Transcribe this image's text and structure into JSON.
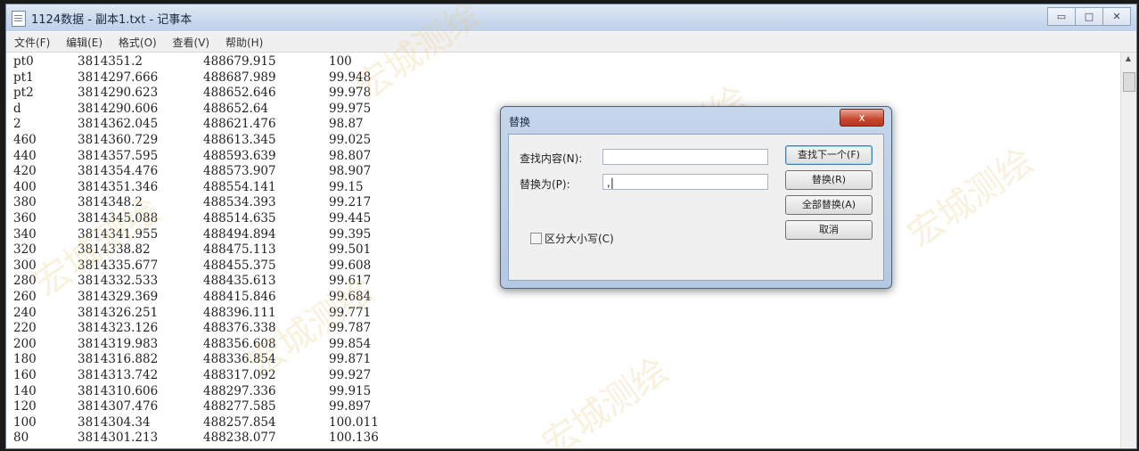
{
  "window": {
    "title": "1124数据 - 副本1.txt - 记事本",
    "buttons": {
      "minimize": "▭",
      "maximize": "□",
      "close": "✕"
    }
  },
  "menu": [
    "文件(F)",
    "编辑(E)",
    "格式(O)",
    "查看(V)",
    "帮助(H)"
  ],
  "rows": [
    [
      "pt0",
      "3814351.2",
      "488679.915",
      "100"
    ],
    [
      "pt1",
      "3814297.666",
      "488687.989",
      "99.948"
    ],
    [
      "pt2",
      "3814290.623",
      "488652.646",
      "99.978"
    ],
    [
      "d",
      "3814290.606",
      "488652.64",
      "99.975"
    ],
    [
      "2",
      "3814362.045",
      "488621.476",
      "98.87"
    ],
    [
      "460",
      "3814360.729",
      "488613.345",
      "99.025"
    ],
    [
      "440",
      "3814357.595",
      "488593.639",
      "98.807"
    ],
    [
      "420",
      "3814354.476",
      "488573.907",
      "98.907"
    ],
    [
      "400",
      "3814351.346",
      "488554.141",
      "99.15"
    ],
    [
      "380",
      "3814348.2",
      "488534.393",
      "99.217"
    ],
    [
      "360",
      "3814345.088",
      "488514.635",
      "99.445"
    ],
    [
      "340",
      "3814341.955",
      "488494.894",
      "99.395"
    ],
    [
      "320",
      "3814338.82",
      "488475.113",
      "99.501"
    ],
    [
      "300",
      "3814335.677",
      "488455.375",
      "99.608"
    ],
    [
      "280",
      "3814332.533",
      "488435.613",
      "99.617"
    ],
    [
      "260",
      "3814329.369",
      "488415.846",
      "99.684"
    ],
    [
      "240",
      "3814326.251",
      "488396.111",
      "99.771"
    ],
    [
      "220",
      "3814323.126",
      "488376.338",
      "99.787"
    ],
    [
      "200",
      "3814319.983",
      "488356.608",
      "99.854"
    ],
    [
      "180",
      "3814316.882",
      "488336.854",
      "99.871"
    ],
    [
      "160",
      "3814313.742",
      "488317.092",
      "99.927"
    ],
    [
      "140",
      "3814310.606",
      "488297.336",
      "99.915"
    ],
    [
      "120",
      "3814307.476",
      "488277.585",
      "99.897"
    ],
    [
      "100",
      "3814304.34",
      "488257.854",
      "100.011"
    ],
    [
      "80",
      "3814301.213",
      "488238.077",
      "100.136"
    ]
  ],
  "watermark_text": "宏城测绘",
  "dialog": {
    "title": "替换",
    "close": "x",
    "find_label": "查找内容(N):",
    "find_value": "",
    "replace_label": "替换为(P):",
    "replace_value": ",|",
    "btn_find_next": "查找下一个(F)",
    "btn_replace": "替换(R)",
    "btn_replace_all": "全部替换(A)",
    "btn_cancel": "取消",
    "match_case": "区分大小写(C)"
  }
}
